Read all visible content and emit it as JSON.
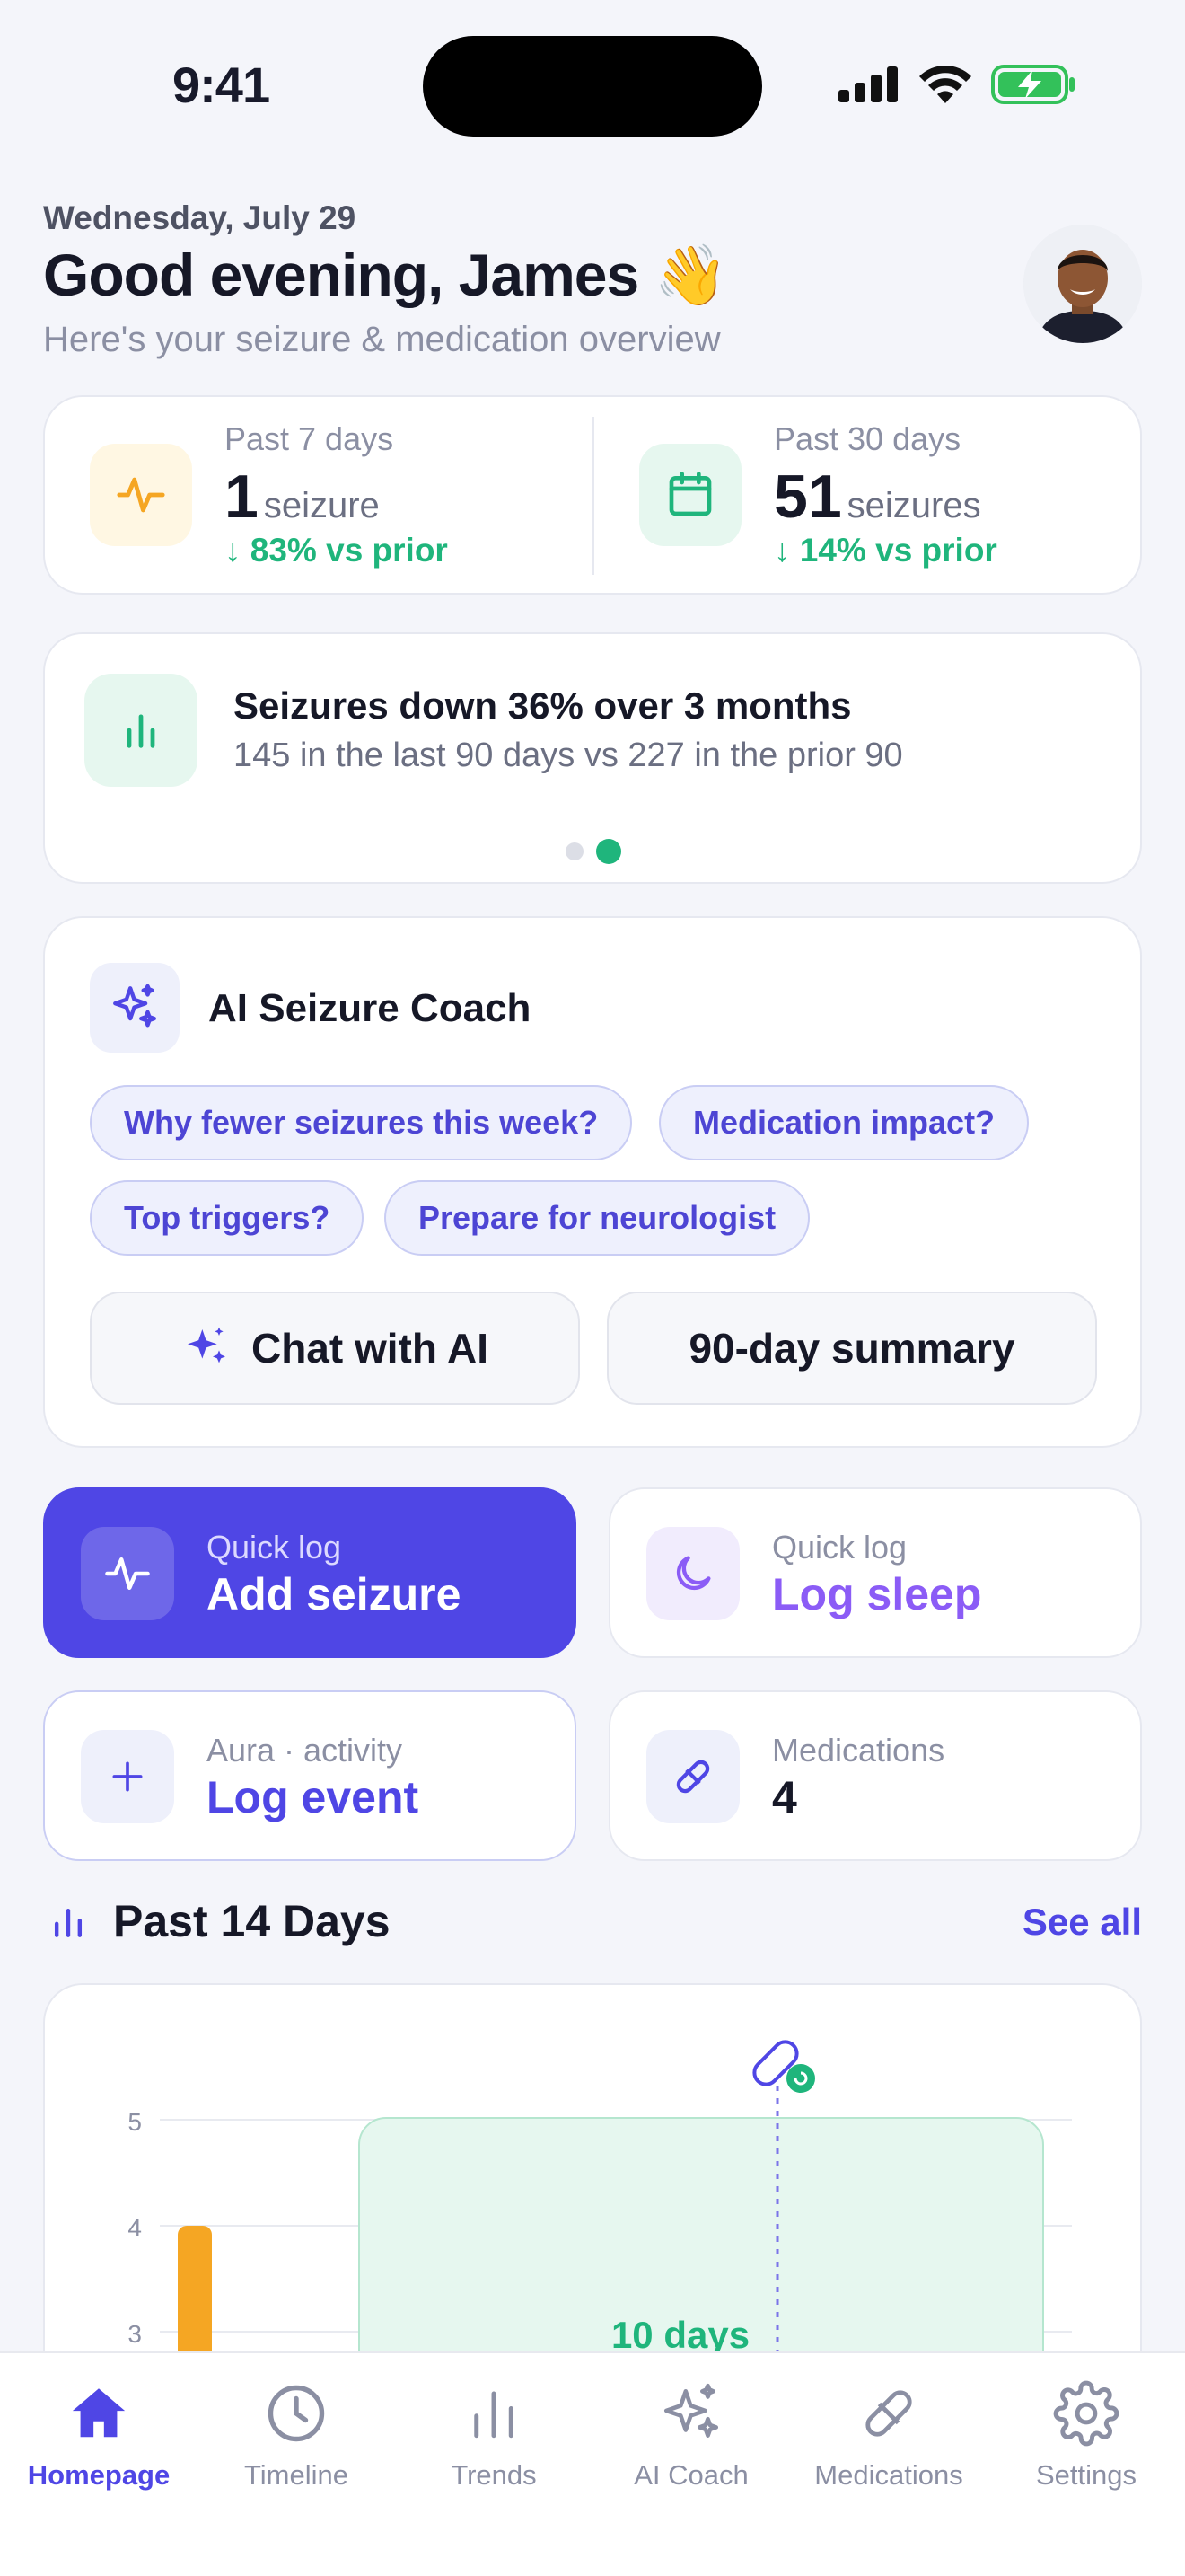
{
  "status_bar": {
    "time": "9:41"
  },
  "header": {
    "date": "Wednesday, July 29",
    "greeting": "Good evening, James 👋",
    "subtitle": "Here's your seizure & medication overview"
  },
  "stats": [
    {
      "label": "Past 7 days",
      "value": "1",
      "unit": "seizure",
      "delta": "↓ 83% vs prior",
      "icon": "activity-pulse-icon",
      "color": "#f5a623"
    },
    {
      "label": "Past 30 days",
      "value": "51",
      "unit": "seizures",
      "delta": "↓ 14% vs prior",
      "icon": "calendar-icon",
      "color": "#1fb57c"
    }
  ],
  "insight": {
    "title": "Seizures down 36% over 3 months",
    "subtitle": "145 in the last 90 days vs 227 in the prior 90",
    "active_page": 2,
    "pages": 2
  },
  "ai_coach": {
    "title": "AI Seizure Coach",
    "chips": [
      "Why fewer seizures this week?",
      "Medication impact?",
      "Top triggers?",
      "Prepare for neurologist"
    ],
    "chat_button": "Chat with AI",
    "summary_button": "90-day summary"
  },
  "tiles": [
    {
      "label": "Quick log",
      "value": "Add seizure",
      "icon": "activity-pulse-icon"
    },
    {
      "label": "Quick log",
      "value": "Log sleep",
      "icon": "moon-icon"
    },
    {
      "label": "Aura · activity",
      "value": "Log event",
      "icon": "plus-icon"
    },
    {
      "label": "Medications",
      "value": "4",
      "icon": "pill-icon"
    }
  ],
  "past14": {
    "title": "Past 14 Days",
    "see_all": "See all"
  },
  "chart_data": {
    "type": "bar",
    "y_ticks": [
      "5",
      "4",
      "3"
    ],
    "values": [
      4
    ],
    "annotation": "10 days",
    "bar_color": "#f5a623",
    "highlight_color": "#e6f7ef"
  },
  "tabs": [
    {
      "label": "Homepage",
      "icon": "home-icon",
      "active": true
    },
    {
      "label": "Timeline",
      "icon": "clock-icon"
    },
    {
      "label": "Trends",
      "icon": "bar-chart-icon"
    },
    {
      "label": "AI Coach",
      "icon": "sparkles-icon"
    },
    {
      "label": "Medications",
      "icon": "pill-icon"
    },
    {
      "label": "Settings",
      "icon": "gear-icon"
    }
  ],
  "colors": {
    "accent": "#4f46e5",
    "success": "#1fb57c",
    "warning": "#f5a623",
    "sleep": "#8b5cf6"
  }
}
